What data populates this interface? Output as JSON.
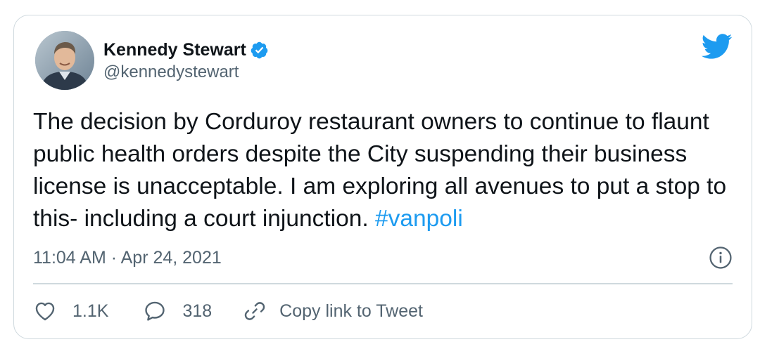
{
  "author": {
    "name": "Kennedy Stewart",
    "handle": "@kennedystewart",
    "verified": true,
    "avatar_icon": "profile-photo"
  },
  "tweet": {
    "text": "The decision by Corduroy restaurant owners to continue to flaunt public health orders despite the City suspending their business license is unacceptable. I am exploring all avenues to put a stop to this- including a court injunction.",
    "hashtag": "#vanpoli",
    "timestamp": "11:04 AM · Apr 24, 2021"
  },
  "actions": {
    "likes": "1.1K",
    "replies": "318",
    "copy_link_label": "Copy link to Tweet"
  },
  "colors": {
    "accent": "#1d9bf0",
    "text": "#0f1419",
    "secondary_text": "#536471",
    "border": "#cfd9de"
  },
  "icons": {
    "brand": "twitter-bird-icon",
    "verified": "verified-badge-icon",
    "info": "info-icon",
    "like": "heart-icon",
    "reply": "comment-bubble-icon",
    "copy": "link-icon"
  }
}
